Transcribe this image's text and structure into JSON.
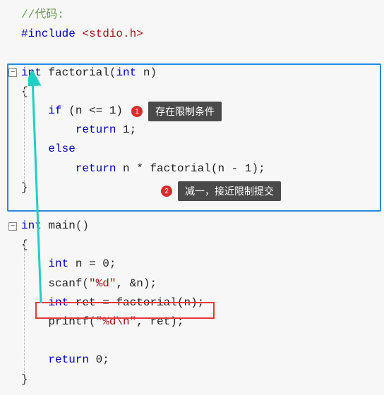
{
  "code": {
    "comment_line": "//代码:",
    "include_kw": "#include ",
    "include_hdr": "<stdio.h>",
    "fn_type": "int",
    "fn_name": " factorial",
    "fn_params_open": "(",
    "fn_param_type": "int",
    "fn_param_name": " n",
    "fn_params_close": ")",
    "open_brace": "{",
    "if_kw": "if",
    "if_cond": " (n <= 1)",
    "return_kw": "return",
    "return_1": " 1;",
    "else_kw": "else",
    "return_expr": " n * ",
    "call_name": "factorial",
    "call_args": "(n - 1);",
    "close_brace": "}",
    "main_type": "int",
    "main_name": " main",
    "main_parens": "()",
    "decl_n": "int",
    "decl_n_rest": " n = 0;",
    "scanf_name": "scanf",
    "scanf_open": "(",
    "scanf_fmt": "\"%d\"",
    "scanf_rest": ", &n);",
    "decl_ret_type": "int",
    "decl_ret_name": " ret = ",
    "decl_ret_call": "factorial",
    "decl_ret_args": "(n);",
    "printf_name": "printf",
    "printf_open": "(",
    "printf_fmt": "\"%d\\n\"",
    "printf_rest": ", ret);",
    "return_0": " 0;"
  },
  "annotations": {
    "badge1": "1",
    "tooltip1": "存在限制条件",
    "badge2": "2",
    "tooltip2": "减一，接近限制提交"
  },
  "gutter": {
    "collapse": "−"
  }
}
